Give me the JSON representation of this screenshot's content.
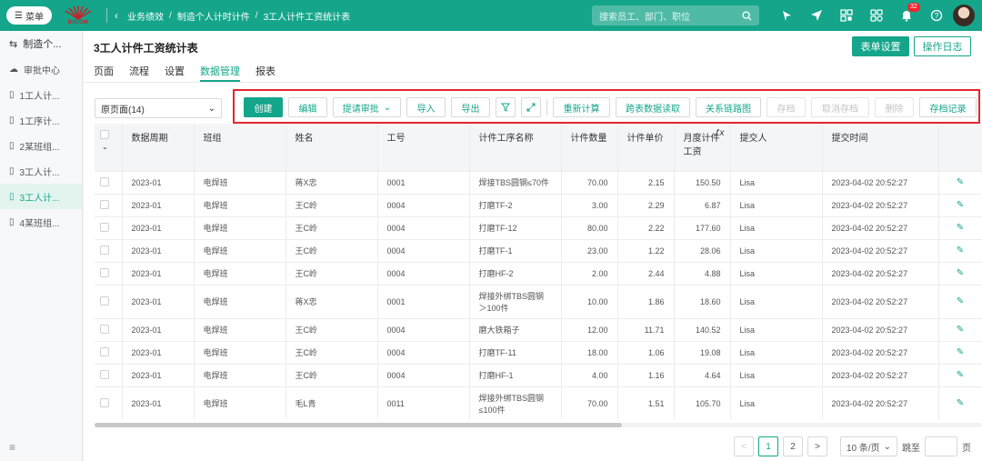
{
  "topbar": {
    "menu_label": "菜单",
    "logo_text": "BICOM",
    "breadcrumb": [
      "业务绩效",
      "制造个人计时计件",
      "3工人计件工资统计表"
    ],
    "search_placeholder": "搜索员工、部门、职位",
    "notification_count": "32",
    "accent_color": "#14a58a",
    "icons": [
      "pin-icon",
      "send-icon",
      "qrcode-icon",
      "apps-icon",
      "bell-icon",
      "help-icon"
    ]
  },
  "sidebar": {
    "items": [
      {
        "label": "制造个...",
        "icon": "swap-icon"
      },
      {
        "label": "审批中心",
        "icon": "cloud-icon"
      },
      {
        "label": "1工人计...",
        "icon": "doc-icon"
      },
      {
        "label": "1工序计...",
        "icon": "doc-icon"
      },
      {
        "label": "2某班组...",
        "icon": "doc-icon"
      },
      {
        "label": "3工人计...",
        "icon": "doc-icon"
      },
      {
        "label": "3工人计...",
        "icon": "doc-icon",
        "active": true
      },
      {
        "label": "4某班组...",
        "icon": "doc-icon"
      }
    ]
  },
  "page": {
    "title": "3工人计件工资统计表",
    "form_settings": "表单设置",
    "op_log": "操作日志",
    "tabs": [
      "页面",
      "流程",
      "设置",
      "数据管理",
      "报表"
    ],
    "active_tab": "数据管理",
    "view_select": "原页面(14)"
  },
  "toolbar": {
    "create": "创建",
    "edit": "编辑",
    "submit": "提请审批",
    "import": "导入",
    "export": "导出",
    "recalc": "重新计算",
    "cross_read": "跨表数据读取",
    "relation": "关系链路图",
    "archive": "存档",
    "unarchive": "取消存档",
    "delete": "删除",
    "archive_log": "存档记录"
  },
  "table": {
    "headers": {
      "period": "数据周期",
      "team": "班组",
      "name": "姓名",
      "worker_id": "工号",
      "process": "计件工序名称",
      "qty": "计件数量",
      "price": "计件单价",
      "wage": "月度计件工资",
      "submitter": "提交人",
      "submit_time": "提交时间"
    },
    "rows": [
      {
        "period": "2023-01",
        "team": "电焊班",
        "name": "蒋X忠",
        "id": "0001",
        "process": "焊接TBS圆钢≤70件",
        "qty": "70.00",
        "price": "2.15",
        "wage": "150.50",
        "submitter": "Lisa",
        "time": "2023-04-02 20:52:27"
      },
      {
        "period": "2023-01",
        "team": "电焊班",
        "name": "王C岭",
        "id": "0004",
        "process": "打磨TF-2",
        "qty": "3.00",
        "price": "2.29",
        "wage": "6.87",
        "submitter": "Lisa",
        "time": "2023-04-02 20:52:27"
      },
      {
        "period": "2023-01",
        "team": "电焊班",
        "name": "王C岭",
        "id": "0004",
        "process": "打磨TF-12",
        "qty": "80.00",
        "price": "2.22",
        "wage": "177.60",
        "submitter": "Lisa",
        "time": "2023-04-02 20:52:27"
      },
      {
        "period": "2023-01",
        "team": "电焊班",
        "name": "王C岭",
        "id": "0004",
        "process": "打磨TF-1",
        "qty": "23.00",
        "price": "1.22",
        "wage": "28.06",
        "submitter": "Lisa",
        "time": "2023-04-02 20:52:27"
      },
      {
        "period": "2023-01",
        "team": "电焊班",
        "name": "王C岭",
        "id": "0004",
        "process": "打磨HF-2",
        "qty": "2.00",
        "price": "2.44",
        "wage": "4.88",
        "submitter": "Lisa",
        "time": "2023-04-02 20:52:27"
      },
      {
        "period": "2023-01",
        "team": "电焊班",
        "name": "蒋X忠",
        "id": "0001",
        "process": "焊接外绑TBS圆钢＞100件",
        "qty": "10.00",
        "price": "1.86",
        "wage": "18.60",
        "submitter": "Lisa",
        "time": "2023-04-02 20:52:27",
        "tall": true
      },
      {
        "period": "2023-01",
        "team": "电焊班",
        "name": "王C岭",
        "id": "0004",
        "process": "磨大铁箱子",
        "qty": "12.00",
        "price": "11.71",
        "wage": "140.52",
        "submitter": "Lisa",
        "time": "2023-04-02 20:52:27"
      },
      {
        "period": "2023-01",
        "team": "电焊班",
        "name": "王C岭",
        "id": "0004",
        "process": "打磨TF-11",
        "qty": "18.00",
        "price": "1.06",
        "wage": "19.08",
        "submitter": "Lisa",
        "time": "2023-04-02 20:52:27"
      },
      {
        "period": "2023-01",
        "team": "电焊班",
        "name": "王C岭",
        "id": "0004",
        "process": "打磨HF-1",
        "qty": "4.00",
        "price": "1.16",
        "wage": "4.64",
        "submitter": "Lisa",
        "time": "2023-04-02 20:52:27"
      },
      {
        "period": "2023-01",
        "team": "电焊班",
        "name": "毛L青",
        "id": "0011",
        "process": "焊接外绑TBS圆钢≤100件",
        "qty": "70.00",
        "price": "1.51",
        "wage": "105.70",
        "submitter": "Lisa",
        "time": "2023-04-02 20:52:27",
        "tall": true
      }
    ]
  },
  "pager": {
    "prev": "<",
    "pages": [
      "1",
      "2"
    ],
    "current": "1",
    "next": ">",
    "page_size": "10 条/页",
    "goto_label": "跳至",
    "page_unit": "页"
  }
}
